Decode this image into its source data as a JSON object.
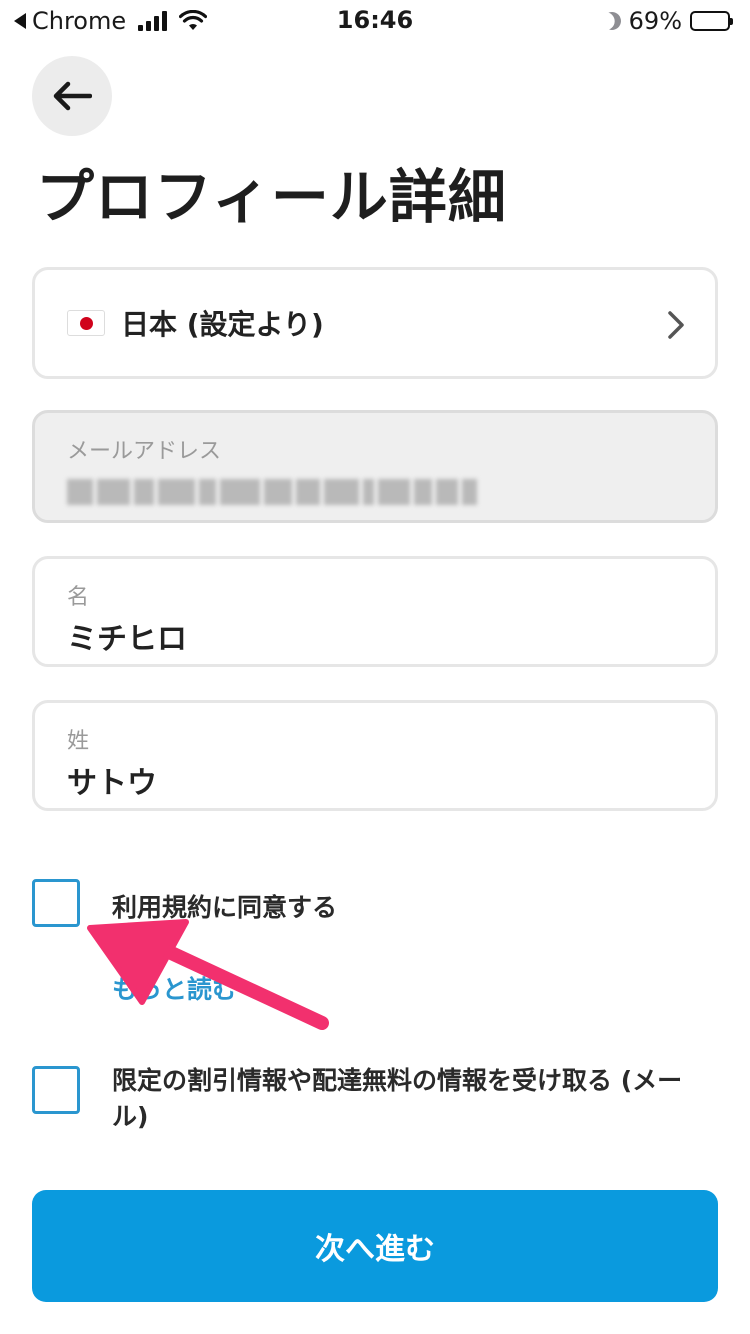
{
  "status_bar": {
    "back_app": "Chrome",
    "time": "16:46",
    "battery": "69%",
    "battery_level": 0.69
  },
  "header": {
    "back_icon": "arrow-left-icon",
    "title": "プロフィール詳細"
  },
  "form": {
    "country": {
      "flag_icon": "japan-flag-icon",
      "value": "日本 (設定より)"
    },
    "email": {
      "label": "メールアドレス",
      "value_redacted": true
    },
    "first_name": {
      "label": "名",
      "value": "ミチヒロ"
    },
    "last_name": {
      "label": "姓",
      "value": "サトウ"
    }
  },
  "consent": {
    "terms_label": "利用規約に同意する",
    "terms_checked": false,
    "read_more": "もっと読む",
    "marketing_label": "限定の割引情報や配達無料の情報を受け取る (メール)",
    "marketing_checked": false
  },
  "actions": {
    "next": "次へ進む"
  },
  "colors": {
    "accent": "#0a9ade",
    "checkbox_border": "#2a96cf",
    "annotation_arrow": "#f2306e"
  }
}
